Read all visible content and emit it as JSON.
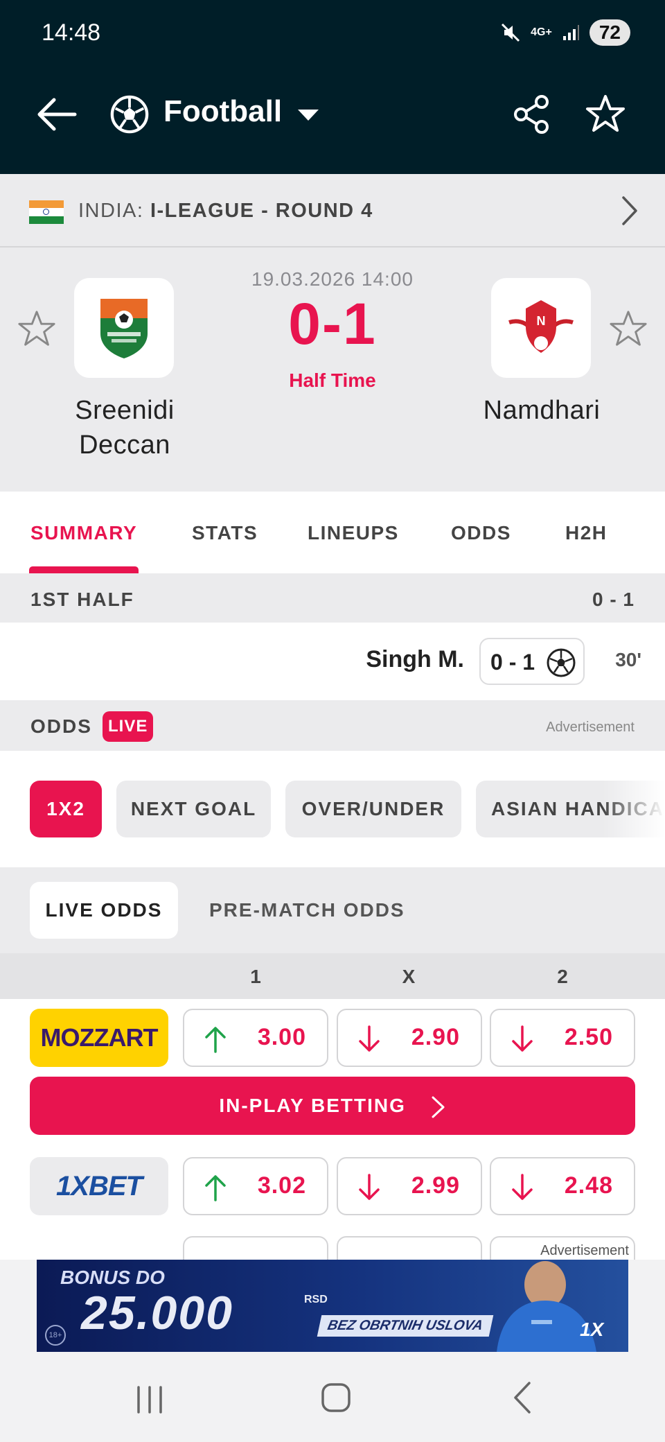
{
  "status_bar": {
    "time": "14:48",
    "network": "4G+",
    "battery": "72"
  },
  "app_bar": {
    "title": "Football"
  },
  "league": {
    "country": "INDIA:",
    "name": "I-LEAGUE - ROUND 4"
  },
  "match": {
    "datetime": "19.03.2026 14:00",
    "score": "0-1",
    "status": "Half Time",
    "home": {
      "name": "Sreenidi Deccan"
    },
    "away": {
      "name": "Namdhari"
    }
  },
  "tabs": [
    "SUMMARY",
    "STATS",
    "LINEUPS",
    "ODDS",
    "H2H"
  ],
  "summary": {
    "half_label": "1ST HALF",
    "half_score": "0 - 1",
    "events": [
      {
        "player": "Singh M.",
        "score": "0 - 1",
        "minute": "30'"
      }
    ]
  },
  "odds": {
    "title": "ODDS",
    "live_badge": "LIVE",
    "ad_label": "Advertisement",
    "markets": [
      "1X2",
      "NEXT GOAL",
      "OVER/UNDER",
      "ASIAN HANDICAP"
    ],
    "odd_types": [
      "LIVE ODDS",
      "PRE-MATCH ODDS"
    ],
    "columns": [
      "1",
      "X",
      "2"
    ],
    "rows": [
      {
        "bookmaker": "MOZZART",
        "odds": [
          {
            "value": "3.00",
            "trend": "up"
          },
          {
            "value": "2.90",
            "trend": "down"
          },
          {
            "value": "2.50",
            "trend": "down"
          }
        ]
      },
      {
        "bookmaker": "1XBET",
        "odds": [
          {
            "value": "3.02",
            "trend": "up"
          },
          {
            "value": "2.99",
            "trend": "down"
          },
          {
            "value": "2.48",
            "trend": "down"
          }
        ]
      }
    ],
    "inplay_button": "IN-PLAY BETTING"
  },
  "ad_banner": {
    "label": "Advertisement",
    "bonus": "BONUS DO",
    "amount": "25.000",
    "currency": "RSD",
    "tag": "BEZ OBRTNIH USLOVA"
  },
  "colors": {
    "accent": "#e8144f",
    "header_bg": "#001e28",
    "odds_up": "#1fa34a",
    "odds_down": "#e8144f",
    "mozzart_yellow": "#ffd200"
  }
}
